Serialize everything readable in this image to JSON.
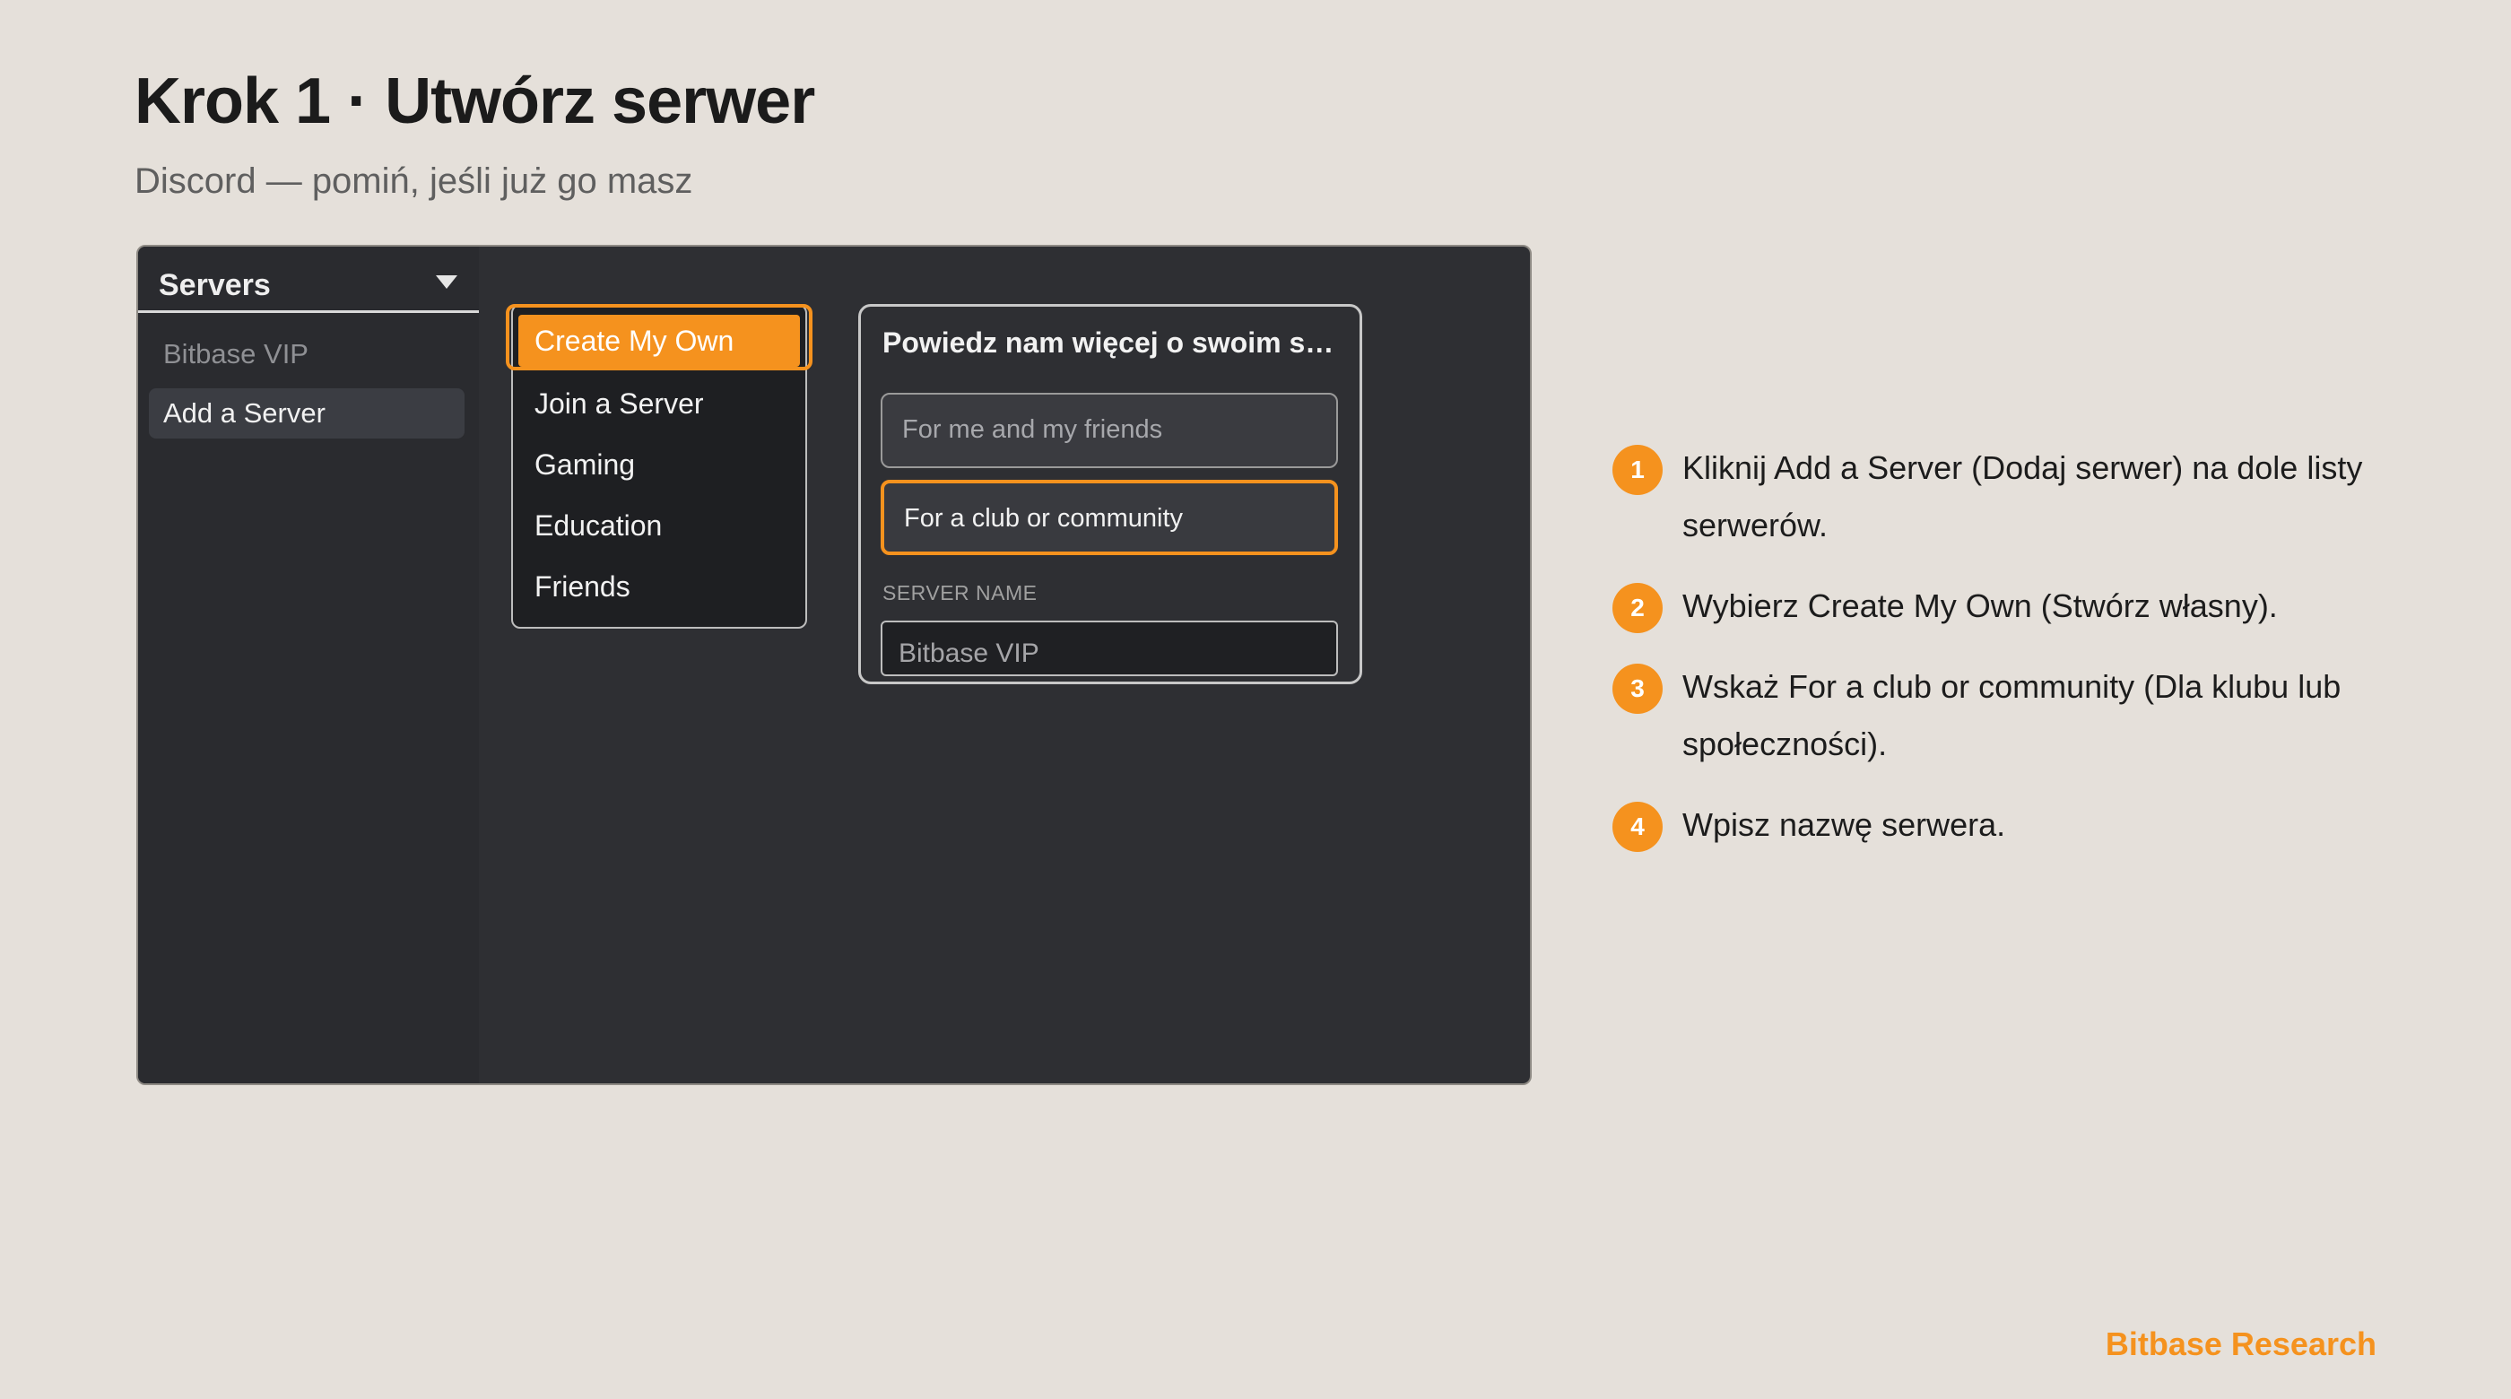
{
  "header": {
    "title": "Krok 1 · Utwórz serwer",
    "subtitle": "Discord — pomiń, jeśli już go masz"
  },
  "mock": {
    "sidebar": {
      "header_label": "Servers",
      "items": [
        {
          "label": "Bitbase VIP"
        },
        {
          "label": "Add a Server"
        }
      ]
    },
    "menu": {
      "items": [
        {
          "label": "Create My Own",
          "selected": true
        },
        {
          "label": "Join a Server"
        },
        {
          "label": "Gaming"
        },
        {
          "label": "Education"
        },
        {
          "label": "Friends"
        }
      ]
    },
    "dialog": {
      "title": "Powiedz nam więcej o swoim serwerze",
      "options": [
        {
          "label": "For me and my friends"
        },
        {
          "label": "For a club or community",
          "selected": true
        }
      ],
      "field_label": "SERVER NAME",
      "field_value": "Bitbase VIP"
    }
  },
  "steps": [
    {
      "num": "1",
      "text": "Kliknij Add a Server (Dodaj serwer) na dole listy serwerów."
    },
    {
      "num": "2",
      "text": "Wybierz Create My Own (Stwórz własny)."
    },
    {
      "num": "3",
      "text": "Wskaż For a club or community (Dla klubu lub społeczności)."
    },
    {
      "num": "4",
      "text": "Wpisz nazwę serwera."
    }
  ],
  "footer": {
    "brand": "Bitbase Research"
  },
  "colors": {
    "accent": "#f5921e",
    "background": "#e5e0da",
    "window": "#2e2f33"
  }
}
